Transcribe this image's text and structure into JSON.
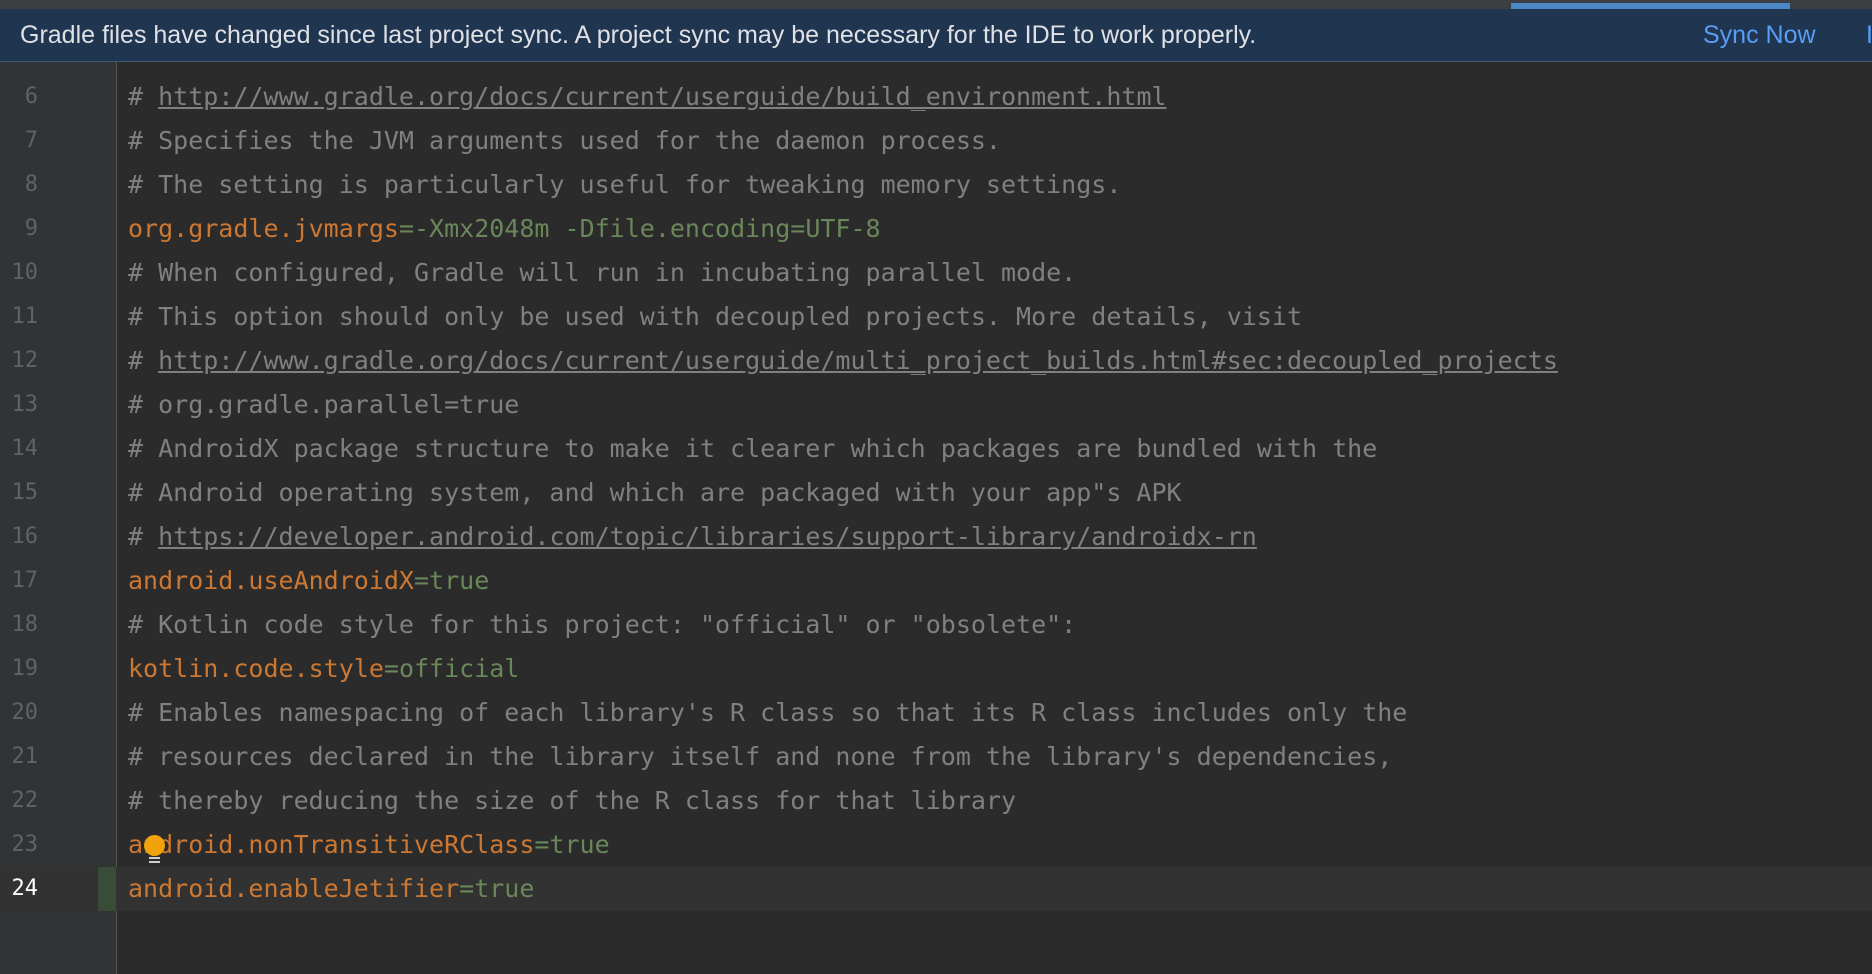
{
  "notification": {
    "message": "Gradle files have changed since last project sync. A project sync may be necessary for the IDE to work properly.",
    "sync_now_label": "Sync Now",
    "overflow_label": "I"
  },
  "editor": {
    "current_line": "24",
    "lines": [
      {
        "number": "6",
        "prefix": "# ",
        "url": "http://www.gradle.org/docs/current/userguide/build_environment.html"
      },
      {
        "number": "7",
        "comment": "# Specifies the JVM arguments used for the daemon process."
      },
      {
        "number": "8",
        "comment": "# The setting is particularly useful for tweaking memory settings."
      },
      {
        "number": "9",
        "key": "org.gradle.jvmargs",
        "eq": "=",
        "value": "-Xmx2048m -Dfile.encoding=UTF-8"
      },
      {
        "number": "10",
        "comment": "# When configured, Gradle will run in incubating parallel mode."
      },
      {
        "number": "11",
        "comment": "# This option should only be used with decoupled projects. More details, visit"
      },
      {
        "number": "12",
        "prefix": "# ",
        "url": "http://www.gradle.org/docs/current/userguide/multi_project_builds.html#sec:decoupled_projects"
      },
      {
        "number": "13",
        "comment": "# org.gradle.parallel=true"
      },
      {
        "number": "14",
        "comment": "# AndroidX package structure to make it clearer which packages are bundled with the"
      },
      {
        "number": "15",
        "comment": "# Android operating system, and which are packaged with your app\"s APK"
      },
      {
        "number": "16",
        "prefix": "# ",
        "url": "https://developer.android.com/topic/libraries/support-library/androidx-rn"
      },
      {
        "number": "17",
        "key": "android.useAndroidX",
        "eq": "=",
        "value": "true"
      },
      {
        "number": "18",
        "comment": "# Kotlin code style for this project: \"official\" or \"obsolete\":"
      },
      {
        "number": "19",
        "key": "kotlin.code.style",
        "eq": "=",
        "value": "official"
      },
      {
        "number": "20",
        "comment": "# Enables namespacing of each library's R class so that its R class includes only the"
      },
      {
        "number": "21",
        "comment": "# resources declared in the library itself and none from the library's dependencies,"
      },
      {
        "number": "22",
        "comment": "# thereby reducing the size of the R class for that library"
      },
      {
        "number": "23",
        "key": "android.nonTransitiveRClass",
        "eq": "=",
        "value": "true"
      },
      {
        "number": "24",
        "key": "android.enableJetifier",
        "eq": "=",
        "value": "true"
      }
    ]
  },
  "colors": {
    "editor_background": "#2b2b2b",
    "banner_background": "#1f3550",
    "link": "#589df6",
    "comment": "#808080",
    "property_key": "#cc7832",
    "property_value": "#6a8759",
    "intention_bulb": "#f0a30a"
  },
  "icons": {
    "intention_bulb": "lightbulb-icon"
  }
}
